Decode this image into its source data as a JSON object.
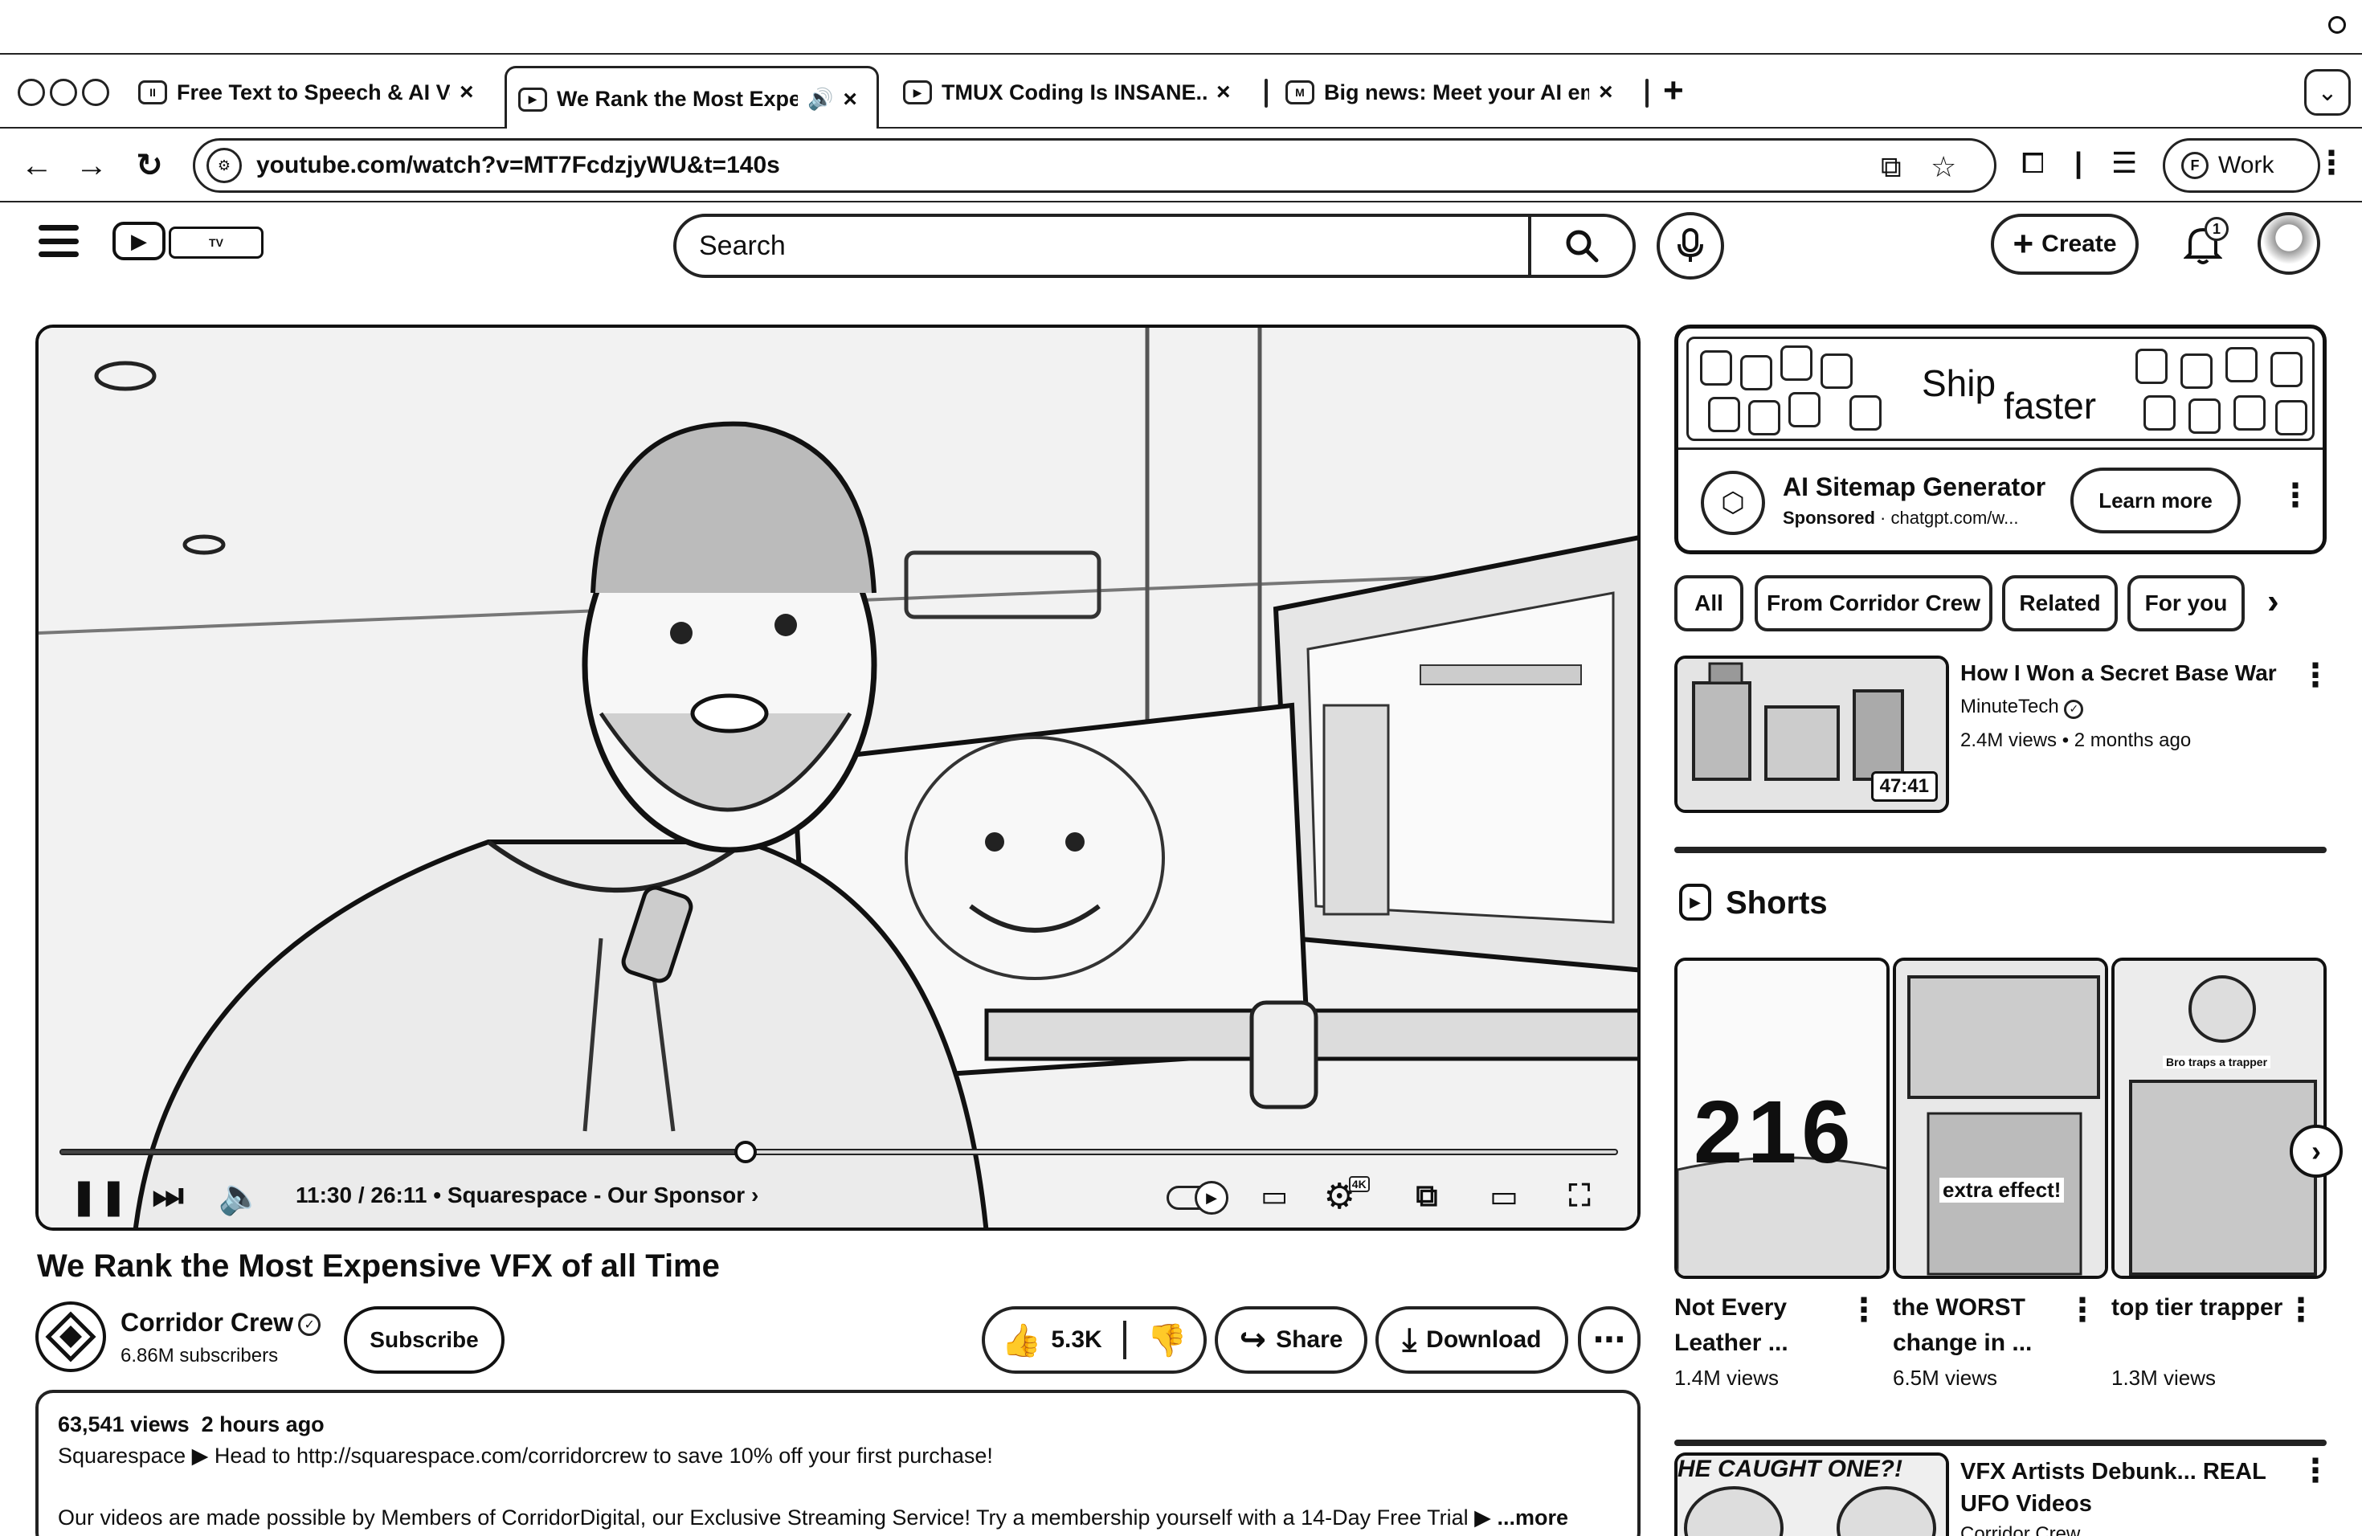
{
  "browser": {
    "tabs": [
      {
        "title": "Free Text to Speech & AI Voice",
        "favicon": "II"
      },
      {
        "title": "We Rank the Most Expensive VFX of all Time",
        "favicon": "▶",
        "audio": true
      },
      {
        "title": "TMUX Coding Is INSANE... Up",
        "favicon": "▶"
      },
      {
        "title": "Big news: Meet your AI email",
        "favicon": "M"
      }
    ],
    "url": "youtube.com/watch?v=MT7FcdzjyWU&t=140s",
    "profile_label": "Work",
    "profile_initial": "F"
  },
  "youtube": {
    "search_placeholder": "Search",
    "create_label": "Create",
    "notification_count": "1",
    "logo_text": "TV"
  },
  "video": {
    "title": "We Rank the Most Expensive VFX of all Time",
    "time": "11:30 / 26:11",
    "chapter": "• Squarespace - Our Sponsor",
    "progress_fraction": 0.44,
    "settings_badge": "4K"
  },
  "channel": {
    "name": "Corridor Crew",
    "subscribers": "6.86M subscribers",
    "subscribe_label": "Subscribe"
  },
  "actions": {
    "likes": "5.3K",
    "share_label": "Share",
    "download_label": "Download"
  },
  "description": {
    "views": "63,541 views",
    "age": "2 hours ago",
    "line2": "Squarespace ▶ Head to http://squarespace.com/corridorcrew to save 10% off your first purchase!",
    "line3": "Our videos are made possible by Members of CorridorDigital, our Exclusive Streaming Service! Try a membership yourself with a 14-Day Free Trial ▶",
    "more_label": "...more"
  },
  "ad": {
    "banner_ship": "Ship",
    "banner_faster": "faster",
    "title": "AI Sitemap Generator",
    "sponsored": "Sponsored",
    "domain": "· chatgpt.com/w...",
    "cta": "Learn more"
  },
  "chips": [
    "All",
    "From Corridor Crew",
    "Related",
    "For you"
  ],
  "recommendations": [
    {
      "title": "How I Won a Secret Base War",
      "channel": "MinuteTech",
      "meta": "2.4M views • 2 months ago",
      "duration": "47:41"
    },
    {
      "title": "VFX Artists Debunk... REAL UFO Videos",
      "channel": "Corridor Crew",
      "thumb_caption": "HE CAUGHT ONE?!"
    }
  ],
  "shorts": {
    "heading": "Shorts",
    "items": [
      {
        "title": "Not Every Leather ...",
        "views": "1.4M views",
        "overlay": "216"
      },
      {
        "title": "the WORST change in ...",
        "views": "6.5M views",
        "overlay": "extra effect!"
      },
      {
        "title": "top tier trapper",
        "views": "1.3M views",
        "overlay": "Bro traps a trapper"
      }
    ]
  }
}
